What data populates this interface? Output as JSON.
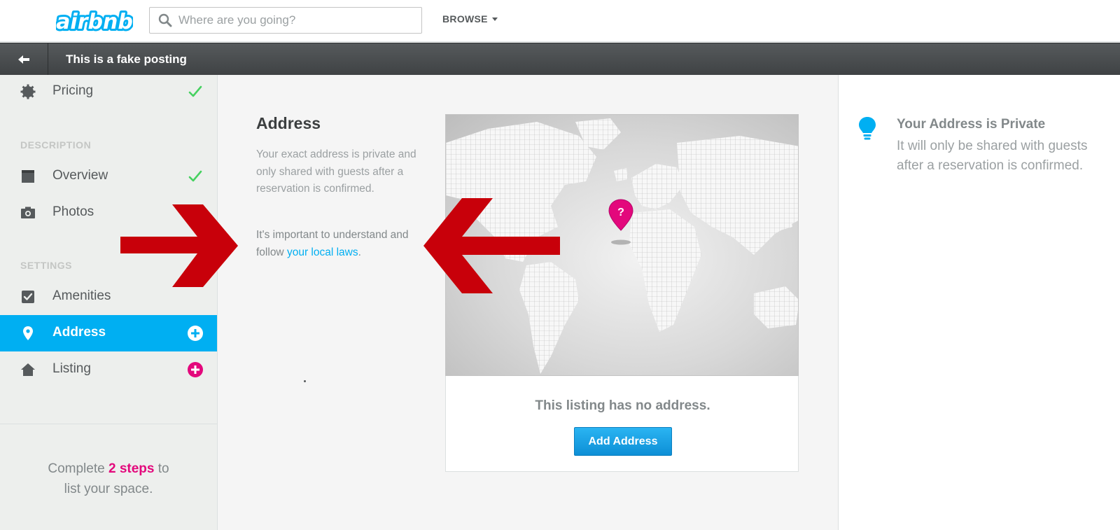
{
  "header": {
    "logo_text": "airbnb",
    "search": {
      "placeholder": "Where are you going?",
      "value": ""
    },
    "browse_label": "BROWSE"
  },
  "subheader": {
    "listing_title": "This is a fake posting"
  },
  "sidebar": {
    "sections": {
      "description": "DESCRIPTION",
      "settings": "SETTINGS"
    },
    "items": [
      {
        "label": "Pricing",
        "icon": "gear-icon",
        "status": "complete"
      },
      {
        "label": "Overview",
        "icon": "document-icon",
        "status": "complete"
      },
      {
        "label": "Photos",
        "icon": "camera-icon",
        "status": "none"
      },
      {
        "label": "Amenities",
        "icon": "checkbox-icon",
        "status": "none"
      },
      {
        "label": "Address",
        "icon": "map-pin-icon",
        "status": "add",
        "active": true
      },
      {
        "label": "Listing",
        "icon": "house-icon",
        "status": "add"
      }
    ],
    "progress": {
      "prefix": "Complete",
      "steps": "2 steps",
      "suffix_line1": "to",
      "line2": "list your space."
    }
  },
  "main": {
    "title": "Address",
    "description": "Your exact address is private and only shared with guests after a reservation is confirmed.",
    "note_prefix": "It's important to understand and follow",
    "note_link": "your local laws",
    "note_suffix": ".",
    "map_pin_symbol": "?",
    "no_address_text": "This listing has no address.",
    "add_address_label": "Add Address"
  },
  "tip": {
    "title": "Your Address is Private",
    "body": "It will only be shared with guests after a reservation is confirmed."
  },
  "colors": {
    "accent_blue": "#00aff2",
    "pink": "#e3087c",
    "check_green": "#46d160",
    "annotation_red": "#c8000a"
  }
}
